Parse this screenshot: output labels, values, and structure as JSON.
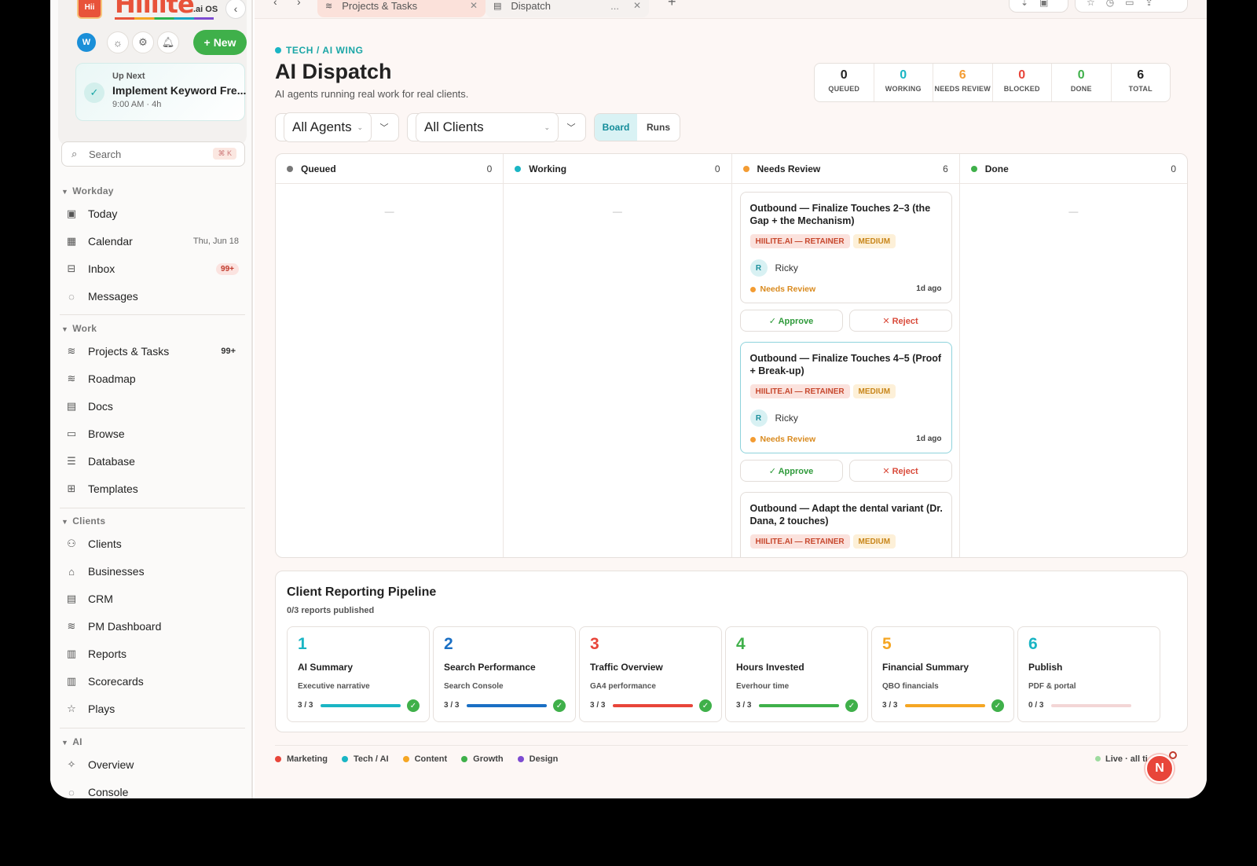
{
  "sidebar": {
    "logo_mark": "Hii",
    "logo_text": "Hiilite",
    "logo_suffix": ".ai OS",
    "user_initial": "W",
    "new_label": "New",
    "up_next": {
      "label": "Up Next",
      "title": "Implement Keyword Fre...",
      "time": "9:00 AM · 4h"
    },
    "search": {
      "placeholder": "Search",
      "shortcut": "⌘ K"
    },
    "sections": {
      "workday": "Workday",
      "work": "Work",
      "clients": "Clients",
      "ai": "AI"
    },
    "items": {
      "today": "Today",
      "calendar": "Calendar",
      "calendar_date": "Thu, Jun 18",
      "inbox": "Inbox",
      "inbox_badge": "99+",
      "messages": "Messages",
      "projects": "Projects & Tasks",
      "projects_count": "99+",
      "roadmap": "Roadmap",
      "docs": "Docs",
      "browse": "Browse",
      "database": "Database",
      "templates": "Templates",
      "clients": "Clients",
      "businesses": "Businesses",
      "crm": "CRM",
      "pm_dashboard": "PM Dashboard",
      "reports": "Reports",
      "scorecards": "Scorecards",
      "plays": "Plays",
      "overview": "Overview",
      "console": "Console"
    }
  },
  "tabs": [
    {
      "label": "Projects & Tasks"
    },
    {
      "label": "Dispatch",
      "extra": "..."
    }
  ],
  "page": {
    "breadcrumb": "TECH / AI WING",
    "title": "AI Dispatch",
    "subtitle": "AI agents running real work for real clients."
  },
  "stats": [
    {
      "value": "0",
      "label": "QUEUED",
      "color": "#222222"
    },
    {
      "value": "0",
      "label": "WORKING",
      "color": "#1ab5c4"
    },
    {
      "value": "6",
      "label": "NEEDS REVIEW",
      "color": "#f39c33"
    },
    {
      "value": "0",
      "label": "BLOCKED",
      "color": "#e8453a"
    },
    {
      "value": "0",
      "label": "DONE",
      "color": "#3fb04a"
    },
    {
      "value": "6",
      "label": "TOTAL",
      "color": "#222222"
    }
  ],
  "filters": {
    "agents": "All Agents",
    "clients": "All Clients",
    "view_board": "Board",
    "view_runs": "Runs"
  },
  "board": {
    "columns": [
      {
        "name": "Queued",
        "count": "0",
        "color": "#777777",
        "empty": "—"
      },
      {
        "name": "Working",
        "count": "0",
        "color": "#1ab5c4",
        "empty": "—"
      },
      {
        "name": "Needs Review",
        "count": "6",
        "color": "#f39c33"
      },
      {
        "name": "Done",
        "count": "0",
        "color": "#3fb04a",
        "empty": "—"
      }
    ],
    "cards": [
      {
        "title": "Outbound — Finalize Touches 2–3 (the Gap + the Mechanism)",
        "client": "HIILITE.AI — RETAINER",
        "priority": "MEDIUM",
        "assignee_initial": "R",
        "assignee": "Ricky",
        "status": "Needs Review",
        "ago": "1d ago"
      },
      {
        "title": "Outbound — Finalize Touches 4–5 (Proof + Break-up)",
        "client": "HIILITE.AI — RETAINER",
        "priority": "MEDIUM",
        "assignee_initial": "R",
        "assignee": "Ricky",
        "status": "Needs Review",
        "ago": "1d ago"
      },
      {
        "title": "Outbound — Adapt the dental variant (Dr. Dana, 2 touches)",
        "client": "HIILITE.AI — RETAINER",
        "priority": "MEDIUM"
      }
    ],
    "approve_label": "✓ Approve",
    "reject_label": "✕ Reject"
  },
  "pipeline": {
    "title": "Client Reporting Pipeline",
    "subtitle": "0/3 reports published",
    "steps": [
      {
        "num": "1",
        "name": "AI Summary",
        "desc": "Executive narrative",
        "progress": "3 / 3",
        "fraction": 1.0,
        "color": "#1ab5c4",
        "done": true
      },
      {
        "num": "2",
        "name": "Search Performance",
        "desc": "Search Console",
        "progress": "3 / 3",
        "fraction": 1.0,
        "color": "#1a6fc4",
        "done": true
      },
      {
        "num": "3",
        "name": "Traffic Overview",
        "desc": "GA4 performance",
        "progress": "3 / 3",
        "fraction": 1.0,
        "color": "#e8453a",
        "done": true
      },
      {
        "num": "4",
        "name": "Hours Invested",
        "desc": "Everhour time",
        "progress": "3 / 3",
        "fraction": 1.0,
        "color": "#3fb04a",
        "done": true
      },
      {
        "num": "5",
        "name": "Financial Summary",
        "desc": "QBO financials",
        "progress": "3 / 3",
        "fraction": 1.0,
        "color": "#f5a623",
        "done": true
      },
      {
        "num": "6",
        "name": "Publish",
        "desc": "PDF & portal",
        "progress": "0 / 3",
        "fraction": 0.0,
        "color": "#1ab5c4",
        "done": false
      }
    ]
  },
  "legend": [
    {
      "label": "Marketing",
      "color": "#e8453a"
    },
    {
      "label": "Tech / AI",
      "color": "#1ab5c4"
    },
    {
      "label": "Content",
      "color": "#f5a623"
    },
    {
      "label": "Growth",
      "color": "#3fb04a"
    },
    {
      "label": "Design",
      "color": "#7d4bd1"
    }
  ],
  "live_label": "Live · all ti",
  "fab_label": "N"
}
